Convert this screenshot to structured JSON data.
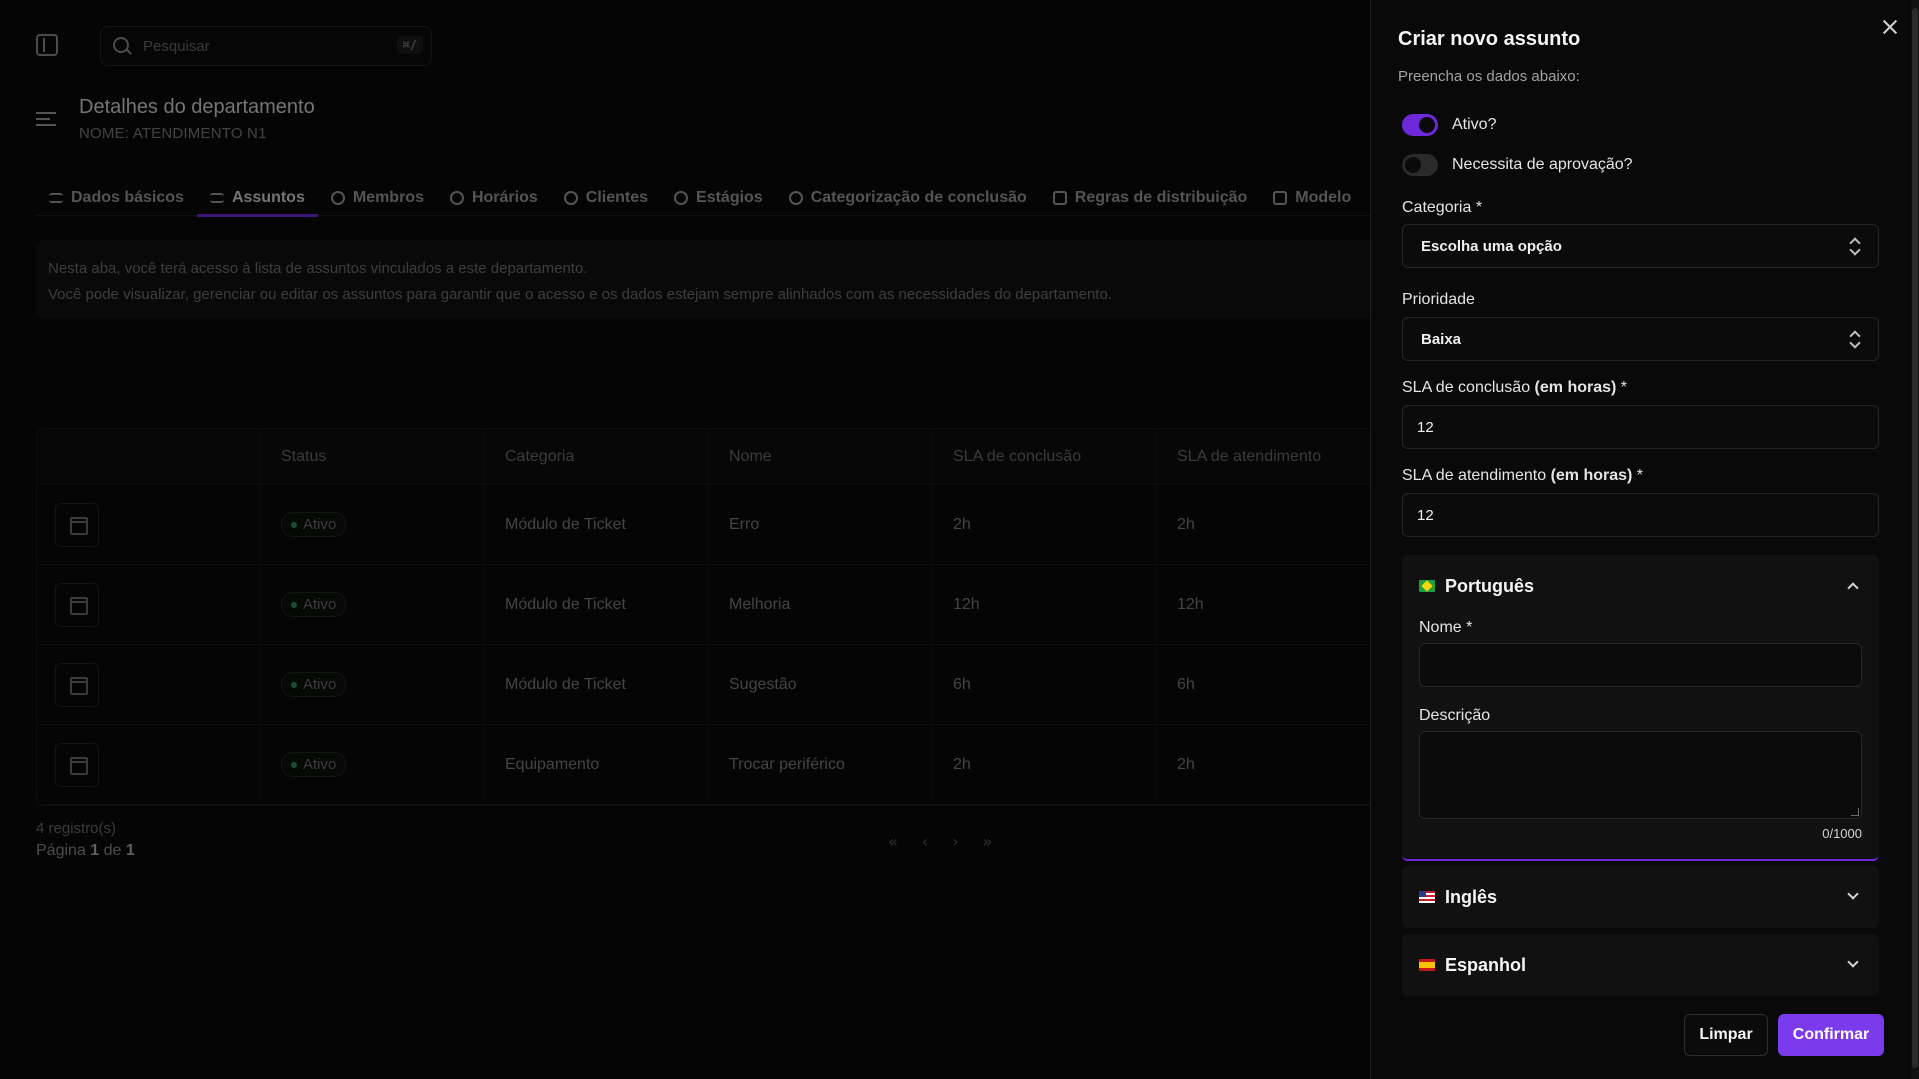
{
  "search": {
    "placeholder": "Pesquisar",
    "shortcut": "⌘/"
  },
  "page": {
    "title": "Detalhes do departamento",
    "subtitle": "NOME: ATENDIMENTO N1"
  },
  "tabs": [
    {
      "label": "Dados básicos",
      "icon": "list-icon"
    },
    {
      "label": "Assuntos",
      "icon": "list-check-icon",
      "active": true
    },
    {
      "label": "Membros",
      "icon": "users-icon"
    },
    {
      "label": "Horários",
      "icon": "clock-icon"
    },
    {
      "label": "Clientes",
      "icon": "users-icon"
    },
    {
      "label": "Estágios",
      "icon": "arrow-circle-icon"
    },
    {
      "label": "Categorização de conclusão",
      "icon": "arrow-circle-icon"
    },
    {
      "label": "Regras de distribuição",
      "icon": "square-icon"
    },
    {
      "label": "Modelo",
      "icon": "document-icon"
    }
  ],
  "info": {
    "line1": "Nesta aba, você terá acesso à lista de assuntos vinculados a este departamento.",
    "line2": "Você pode visualizar, gerenciar ou editar os assuntos para garantir que o acesso e os dados estejam sempre alinhados com as necessidades do departamento."
  },
  "table": {
    "headers": [
      "",
      "Status",
      "Categoria",
      "Nome",
      "SLA de conclusão",
      "SLA de atendimento",
      ""
    ],
    "rows": [
      {
        "status": "Ativo",
        "categoria": "Módulo de Ticket",
        "nome": "Erro",
        "sla_conclusao": "2h",
        "sla_atendimento": "2h"
      },
      {
        "status": "Ativo",
        "categoria": "Módulo de Ticket",
        "nome": "Melhoria",
        "sla_conclusao": "12h",
        "sla_atendimento": "12h"
      },
      {
        "status": "Ativo",
        "categoria": "Módulo de Ticket",
        "nome": "Sugestão",
        "sla_conclusao": "6h",
        "sla_atendimento": "6h"
      },
      {
        "status": "Ativo",
        "categoria": "Equipamento",
        "nome": "Trocar periférico",
        "sla_conclusao": "2h",
        "sla_atendimento": "2h"
      }
    ],
    "records": "4 registro(s)",
    "page_prefix": "Página",
    "page_current": "1",
    "page_of": "de",
    "page_total": "1"
  },
  "pager": {
    "first": "«",
    "prev": "‹",
    "next": "›",
    "last": "»"
  },
  "drawer": {
    "title": "Criar novo assunto",
    "subtitle": "Preencha os dados abaixo:",
    "toggle_active": {
      "label": "Ativo?",
      "on": true
    },
    "toggle_approval": {
      "label": "Necessita de aprovação?",
      "on": false
    },
    "categoria": {
      "label": "Categoria *",
      "value": "Escolha uma opção"
    },
    "prioridade": {
      "label": "Prioridade",
      "value": "Baixa"
    },
    "sla_conclusao": {
      "label": "SLA de conclusão",
      "label_bold": "(em horas)",
      "label_suffix": " *",
      "value": "12"
    },
    "sla_atendimento": {
      "label": "SLA de atendimento",
      "label_bold": "(em horas)",
      "label_suffix": " *",
      "value": "12"
    },
    "languages": [
      {
        "name": "Português",
        "flag": "brazil-flag",
        "open": true
      },
      {
        "name": "Inglês",
        "flag": "usa-flag",
        "open": false
      },
      {
        "name": "Espanhol",
        "flag": "spain-flag",
        "open": false
      }
    ],
    "nome_label": "Nome *",
    "descricao_label": "Descrição",
    "counter": "0/1000",
    "clear_label": "Limpar",
    "confirm_label": "Confirmar"
  },
  "colors": {
    "accent": "#7c3aed",
    "background": "#0a0a0a",
    "panel": "#111111"
  }
}
